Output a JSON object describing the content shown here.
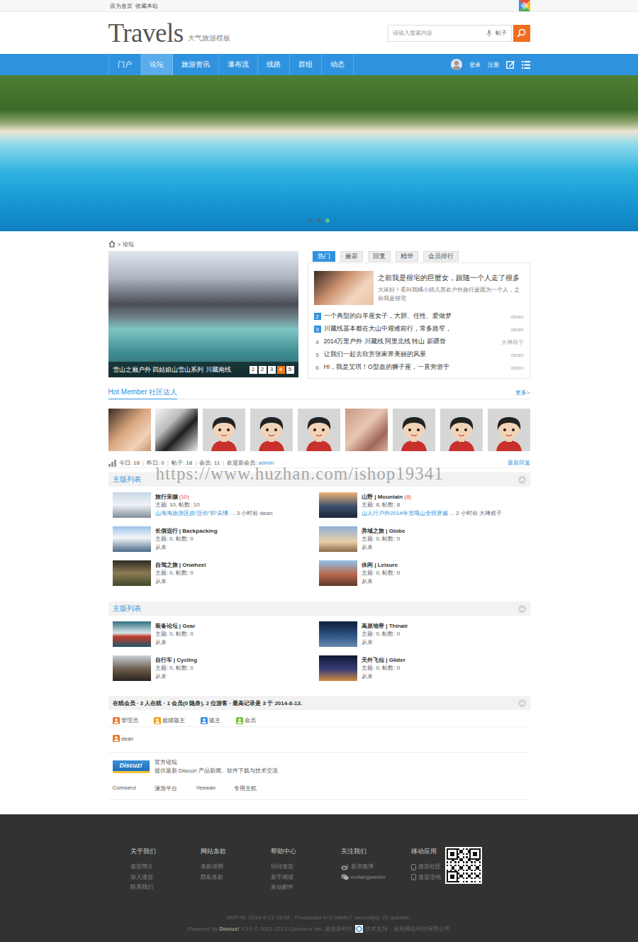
{
  "topbar": {
    "links": [
      "设为首页",
      "收藏本站"
    ]
  },
  "header": {
    "logo": "Travels",
    "tagline": "大气旅游模板",
    "search": {
      "placeholder": "请输入搜索内容",
      "scope": "帖子"
    }
  },
  "nav": {
    "items": [
      {
        "label": "门户",
        "selected": false
      },
      {
        "label": "论坛",
        "selected": true
      },
      {
        "label": "旅游资讯",
        "selected": false
      },
      {
        "label": "瀑布流",
        "selected": false
      },
      {
        "label": "线路",
        "selected": false
      },
      {
        "label": "群组",
        "selected": false
      },
      {
        "label": "动态",
        "selected": false
      }
    ],
    "user_links": [
      "登录",
      "注册"
    ]
  },
  "banner": {
    "dots": [
      {
        "selected": false
      },
      {
        "selected": false
      },
      {
        "selected": true
      }
    ]
  },
  "breadcrumb": {
    "separator": ">",
    "current": "论坛"
  },
  "slideshow": {
    "caption": "雪山之巅户外 四姑娘山雪山系列 川藏南线",
    "pages": [
      {
        "label": "1",
        "selected": false
      },
      {
        "label": "2",
        "selected": false
      },
      {
        "label": "3",
        "selected": false
      },
      {
        "label": "4",
        "selected": true
      },
      {
        "label": "5",
        "selected": false
      }
    ]
  },
  "feed": {
    "tabs": [
      {
        "label": "热门",
        "selected": true
      },
      {
        "label": "最新",
        "selected": false
      },
      {
        "label": "回复",
        "selected": false
      },
      {
        "label": "精华",
        "selected": false
      },
      {
        "label": "会员排行",
        "selected": false
      }
    ],
    "featured": {
      "title": "之前我是很宅的巨蟹女，跟随一个人走了很多",
      "summary": "大家好！看叫我橘小妞儿喜欢户外旅行是因为一个人，之前我是很宅"
    },
    "items": [
      {
        "rank": "2",
        "highlight": true,
        "title": "一个典型的白羊座女子，大胆、任性、爱做梦",
        "author": "dean"
      },
      {
        "rank": "3",
        "highlight": true,
        "title": "川藏线基本都在大山中艰难前行，常多路窄，",
        "author": "dean"
      },
      {
        "rank": "4",
        "highlight": false,
        "title": "2014万里户外 川藏线 阿里北线 转山 新疆骨",
        "author": "大禅叔子"
      },
      {
        "rank": "5",
        "highlight": false,
        "title": "让我们一起去欣赏张家界美丽的风景",
        "author": "dean"
      },
      {
        "rank": "6",
        "highlight": false,
        "title": "HI，我是艾琪！O型血的狮子座，一直旁游于",
        "author": "dean"
      }
    ]
  },
  "members": {
    "title": "Hot Member",
    "subtitle": "社区达人",
    "more": "更多>",
    "avatars": [
      {
        "kind": "photo"
      },
      {
        "kind": "photo"
      },
      {
        "kind": "cartoon"
      },
      {
        "kind": "cartoon"
      },
      {
        "kind": "cartoon"
      },
      {
        "kind": "photo"
      },
      {
        "kind": "cartoon"
      },
      {
        "kind": "cartoon"
      },
      {
        "kind": "cartoon"
      }
    ]
  },
  "stats": {
    "separator": "|",
    "items": [
      "今日: 18",
      "昨日: 0",
      "帖子: 18",
      "会员: 11"
    ],
    "welcome": "欢迎新会员: ",
    "newest": "admin",
    "latest": "最新回复"
  },
  "watermark": "https://www.huzhan.com/ishop19341",
  "categories": [
    {
      "title": "主版列表",
      "forums": [
        {
          "name": "旅行采撷",
          "kind": "active",
          "count": "(10)",
          "stats": "主题: 10, 帖数: 10",
          "last": {
            "title": "山海海旅游区由“活动”和“表情 ...",
            "time": "3 小时前",
            "author": "dean"
          }
        },
        {
          "name": "山野 | Mountain",
          "kind": "active",
          "count": "(8)",
          "stats": "主题: 8, 帖数: 8",
          "last": {
            "title": "山人行户外2014年贡嘎山全线穿越 ...",
            "time": "2 小时前",
            "author": "大禅叔子"
          }
        },
        {
          "name": "长假远行 | Backpacking",
          "kind": "empty",
          "stats": "主题: 0, 帖数: 0",
          "never": "从未"
        },
        {
          "name": "异域之旅 | Globe",
          "kind": "empty",
          "stats": "主题: 0, 帖数: 0",
          "never": "从未"
        },
        {
          "name": "自驾之旅 | Onwheel",
          "kind": "empty",
          "stats": "主题: 0, 帖数: 0",
          "never": "从未"
        },
        {
          "name": "休闲 | Leisure",
          "kind": "empty",
          "stats": "主题: 0, 帖数: 0",
          "never": "从未"
        }
      ]
    },
    {
      "title": "主版列表",
      "forums": [
        {
          "name": "装备论坛 | Gear",
          "kind": "empty",
          "stats": "主题: 0, 帖数: 0",
          "never": "从未"
        },
        {
          "name": "高原地带 | Thinair",
          "kind": "empty",
          "stats": "主题: 0, 帖数: 0",
          "never": "从未"
        },
        {
          "name": "自行车 | Cycling",
          "kind": "empty",
          "stats": "主题: 0, 帖数: 0",
          "never": "从未"
        },
        {
          "name": "天外飞仙 | Glider",
          "kind": "empty",
          "stats": "主题: 0, 帖数: 0",
          "never": "从未"
        }
      ]
    }
  ],
  "online": {
    "title": "在线会员 · 3 人在线 · 1 会员(0 隐身), 2 位游客 · 最高记录是 3 于 2014-8-13.",
    "legend": [
      {
        "label": "管理员",
        "color": "#e8762b"
      },
      {
        "label": "超级版主",
        "color": "#f0a020"
      },
      {
        "label": "版主",
        "color": "#3a8ee6"
      },
      {
        "label": "会员",
        "color": "#7cbf3a"
      }
    ],
    "users": [
      {
        "name": "dean",
        "color": "#e8762b"
      }
    ]
  },
  "links": {
    "featured": {
      "logo": "Discuz!",
      "title": "官方论坛",
      "desc": "提供最新 Discuz! 产品新闻、软件下载与技术交流"
    },
    "text": [
      "Comsenz",
      "漫游平台",
      "Yeswan",
      "专用主机"
    ]
  },
  "footer": {
    "columns": [
      {
        "title": "关于我们",
        "links": [
          {
            "label": "道营简介",
            "kind": "text"
          },
          {
            "label": "加入道营",
            "kind": "text"
          },
          {
            "label": "联系我们",
            "kind": "text"
          }
        ]
      },
      {
        "title": "网站条款",
        "links": [
          {
            "label": "条款说明",
            "kind": "text"
          },
          {
            "label": "隐私条款",
            "kind": "text"
          }
        ]
      },
      {
        "title": "帮助中心",
        "links": [
          {
            "label": "玩转道营",
            "kind": "text"
          },
          {
            "label": "新手阅读",
            "kind": "text"
          },
          {
            "label": "发信邮件",
            "kind": "text"
          }
        ]
      },
      {
        "title": "关注我们",
        "links": [
          {
            "label": "新浪微博",
            "kind": "weibo"
          },
          {
            "label": "mofangweixin",
            "kind": "wechat"
          }
        ]
      },
      {
        "title": "移动应用",
        "links": [
          {
            "label": "道营社区",
            "kind": "phone"
          },
          {
            "label": "道营活动",
            "kind": "phone"
          }
        ]
      }
    ],
    "info": "GMT+8, 2014-8-13 15:08 , Processed in 0.086417 second(s), 21 queries .",
    "powered": [
      {
        "text": "Powered by ",
        "bold": false
      },
      {
        "text": "Discuz!",
        "bold": true
      },
      {
        "text": " X3.0 © 2001-2013 Comsenz Inc. 旅游新时代",
        "bold": false
      }
    ],
    "support": "技术支持：迪恩网络科技有限公司"
  }
}
